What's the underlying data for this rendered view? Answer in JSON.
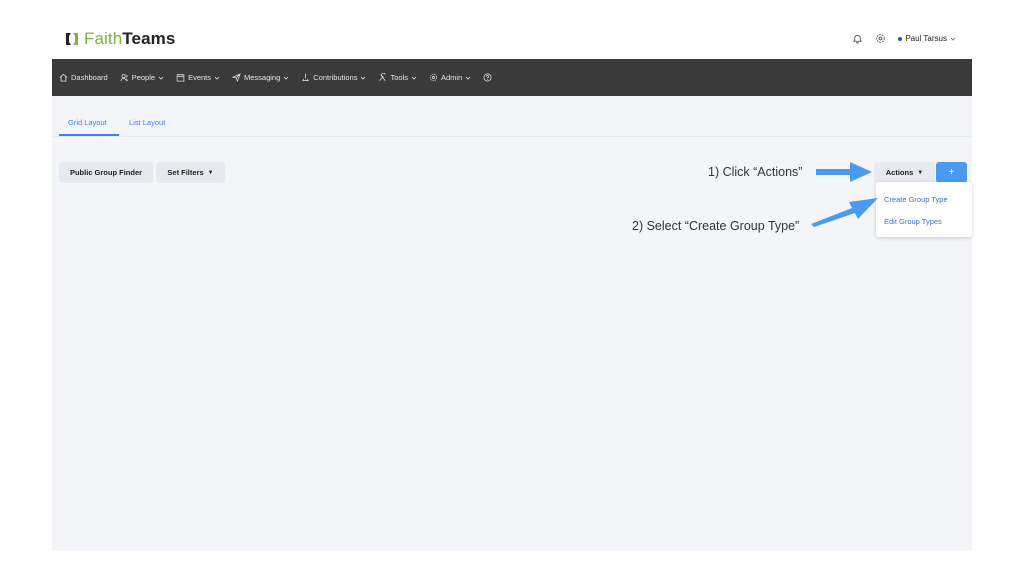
{
  "header": {
    "logo_faith": "Faith",
    "logo_teams": "Teams",
    "user_name": "Paul Tarsus"
  },
  "nav": [
    {
      "label": "Dashboard",
      "icon": "home-icon",
      "has_chevron": false
    },
    {
      "label": "People",
      "icon": "people-icon",
      "has_chevron": true
    },
    {
      "label": "Events",
      "icon": "calendar-icon",
      "has_chevron": true
    },
    {
      "label": "Messaging",
      "icon": "send-icon",
      "has_chevron": true
    },
    {
      "label": "Contributions",
      "icon": "contributions-icon",
      "has_chevron": true
    },
    {
      "label": "Tools",
      "icon": "tools-icon",
      "has_chevron": true
    },
    {
      "label": "Admin",
      "icon": "gear-icon",
      "has_chevron": true
    }
  ],
  "tabs": {
    "grid": "Grid Layout",
    "list": "List Layout"
  },
  "toolbar": {
    "public_group_finder": "Public Group Finder",
    "set_filters": "Set Filters",
    "actions": "Actions",
    "add": "+"
  },
  "actions_menu": {
    "create_group_type": "Create Group Type",
    "edit_group_types": "Edit Group Types"
  },
  "annotations": {
    "step1": "1) Click “Actions”",
    "step2": "2) Select “Create Group Type”"
  },
  "colors": {
    "brand_green": "#7cb342",
    "accent_blue": "#3b82f6",
    "arrow_blue": "#4a9bf0",
    "nav_bg": "#3a3a3a"
  }
}
